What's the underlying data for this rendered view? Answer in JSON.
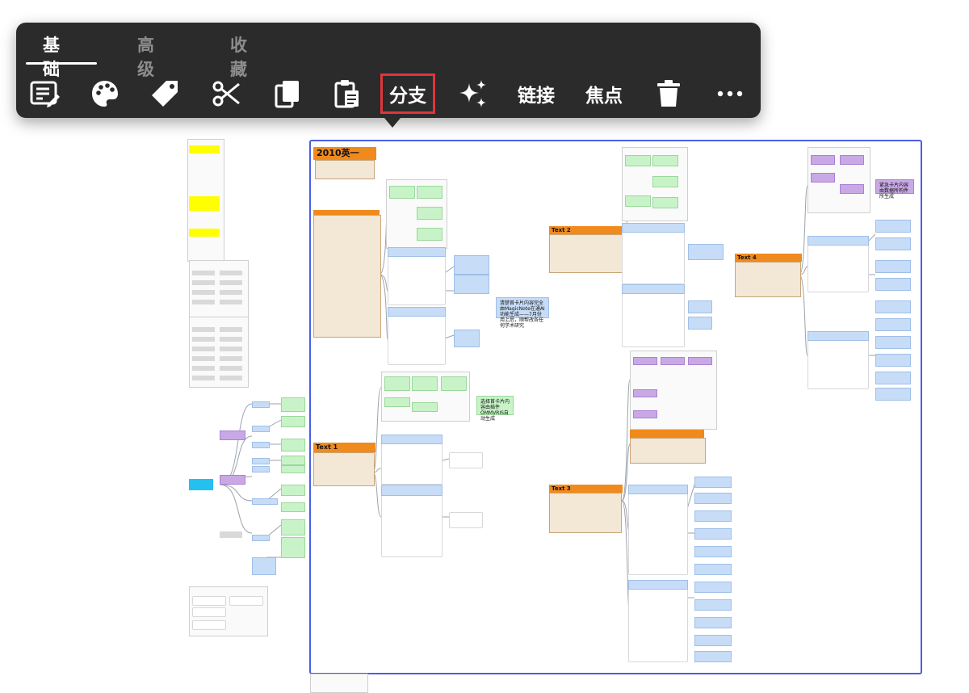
{
  "toolbar": {
    "tabs": [
      {
        "label": "基础",
        "active": true
      },
      {
        "label": "高级",
        "active": false
      },
      {
        "label": "收藏",
        "active": false
      }
    ],
    "tools": [
      {
        "name": "edit-text",
        "icon": "edit-text-icon"
      },
      {
        "name": "style",
        "icon": "palette-icon"
      },
      {
        "name": "tag",
        "icon": "tag-icon"
      },
      {
        "name": "cut",
        "icon": "scissors-icon"
      },
      {
        "name": "copy",
        "icon": "copy-icon"
      },
      {
        "name": "paste",
        "icon": "paste-icon"
      },
      {
        "name": "branch",
        "label": "分支",
        "highlighted": true
      },
      {
        "name": "ai",
        "icon": "sparkle-icon"
      },
      {
        "name": "link",
        "label": "链接"
      },
      {
        "name": "focus",
        "label": "焦点"
      },
      {
        "name": "delete",
        "icon": "trash-icon"
      },
      {
        "name": "more",
        "icon": "more-icon"
      }
    ]
  },
  "canvas": {
    "cards": {
      "title_2010": "2010英一",
      "text1": "Text 1",
      "text2": "Text 2",
      "text3": "Text 3",
      "text4": "Text 4",
      "note_blue_1": "清楚首卡片内容完全由MagicNote在通AI功能生成——7月份用上后，顺帮改各任何学术研究",
      "note_green_1": "选择首卡片内容由插件OMMVRIS自动生成",
      "note_purple_1": "紧急卡片内容由数据所构件所生成"
    },
    "colors": {
      "selection": "#4a5ee8",
      "orange_header": "#f08a1c",
      "blue_note": "#c7dcf7",
      "green_note": "#c8f3c8",
      "purple_note": "#c8a9e6",
      "highlight_border": "#e0353a"
    }
  }
}
